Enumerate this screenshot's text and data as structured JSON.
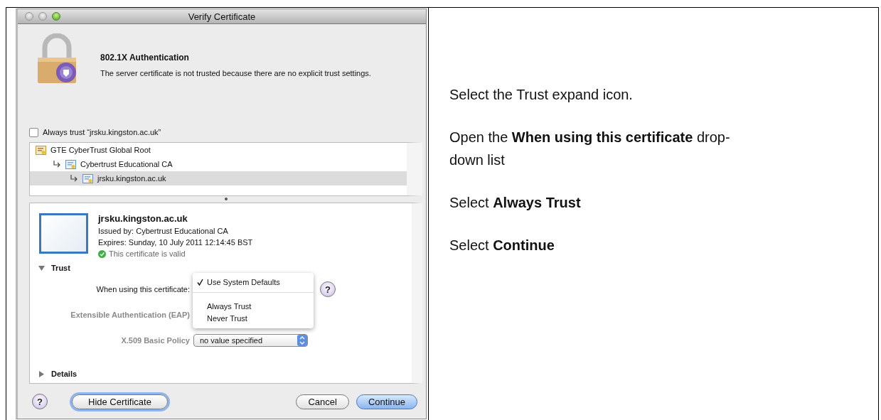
{
  "dialog": {
    "title": "Verify Certificate",
    "heading": "802.1X Authentication",
    "message": "The server certificate is not trusted because there are no explicit trust settings.",
    "always_trust": {
      "label": "Always trust “jrsku.kingston.ac.uk”",
      "checked": false
    },
    "certificate_chain": [
      {
        "label": "GTE CyberTrust Global Root",
        "selected": false,
        "children": [
          {
            "label": "Cybertrust Educational CA",
            "selected": false,
            "children": [
              {
                "label": "jrsku.kingston.ac.uk",
                "selected": true
              }
            ]
          }
        ]
      }
    ],
    "certificate": {
      "name": "jrsku.kingston.ac.uk",
      "issued_by": "Issued by: Cybertrust Educational CA",
      "expires": "Expires: Sunday, 10 July 2011 12:14:45 BST",
      "status": "This certificate is valid"
    },
    "trust": {
      "label": "Trust",
      "expanded": true,
      "rows": [
        {
          "label": "When using this certificate:",
          "disabled": false,
          "help": "?"
        },
        {
          "label": "Extensible Authentication (EAP)",
          "disabled": true
        },
        {
          "label": "X.509 Basic Policy",
          "disabled": true,
          "value": "no value specified"
        }
      ]
    },
    "help_button": "?",
    "menu": [
      {
        "kind": "item",
        "label": "Use System Defaults",
        "checked": true
      },
      {
        "kind": "separator"
      },
      {
        "kind": "item",
        "label": "Always Trust",
        "checked": false
      },
      {
        "kind": "item",
        "label": "Never Trust",
        "checked": false
      }
    ],
    "details": {
      "label": "Details",
      "expanded": false
    },
    "buttons": [
      {
        "label": "Hide Certificate",
        "focused": true,
        "default": false
      },
      {
        "label": "Cancel",
        "focused": false,
        "default": false
      },
      {
        "label": "Continue",
        "focused": false,
        "default": true
      }
    ]
  },
  "instructions": [
    {
      "text": "Select the Trust expand icon."
    },
    {
      "text": "Open the **When using this certificate** drop-down list"
    },
    {
      "text": "Select **Always Trust**"
    },
    {
      "text": "Select **Continue**"
    }
  ]
}
